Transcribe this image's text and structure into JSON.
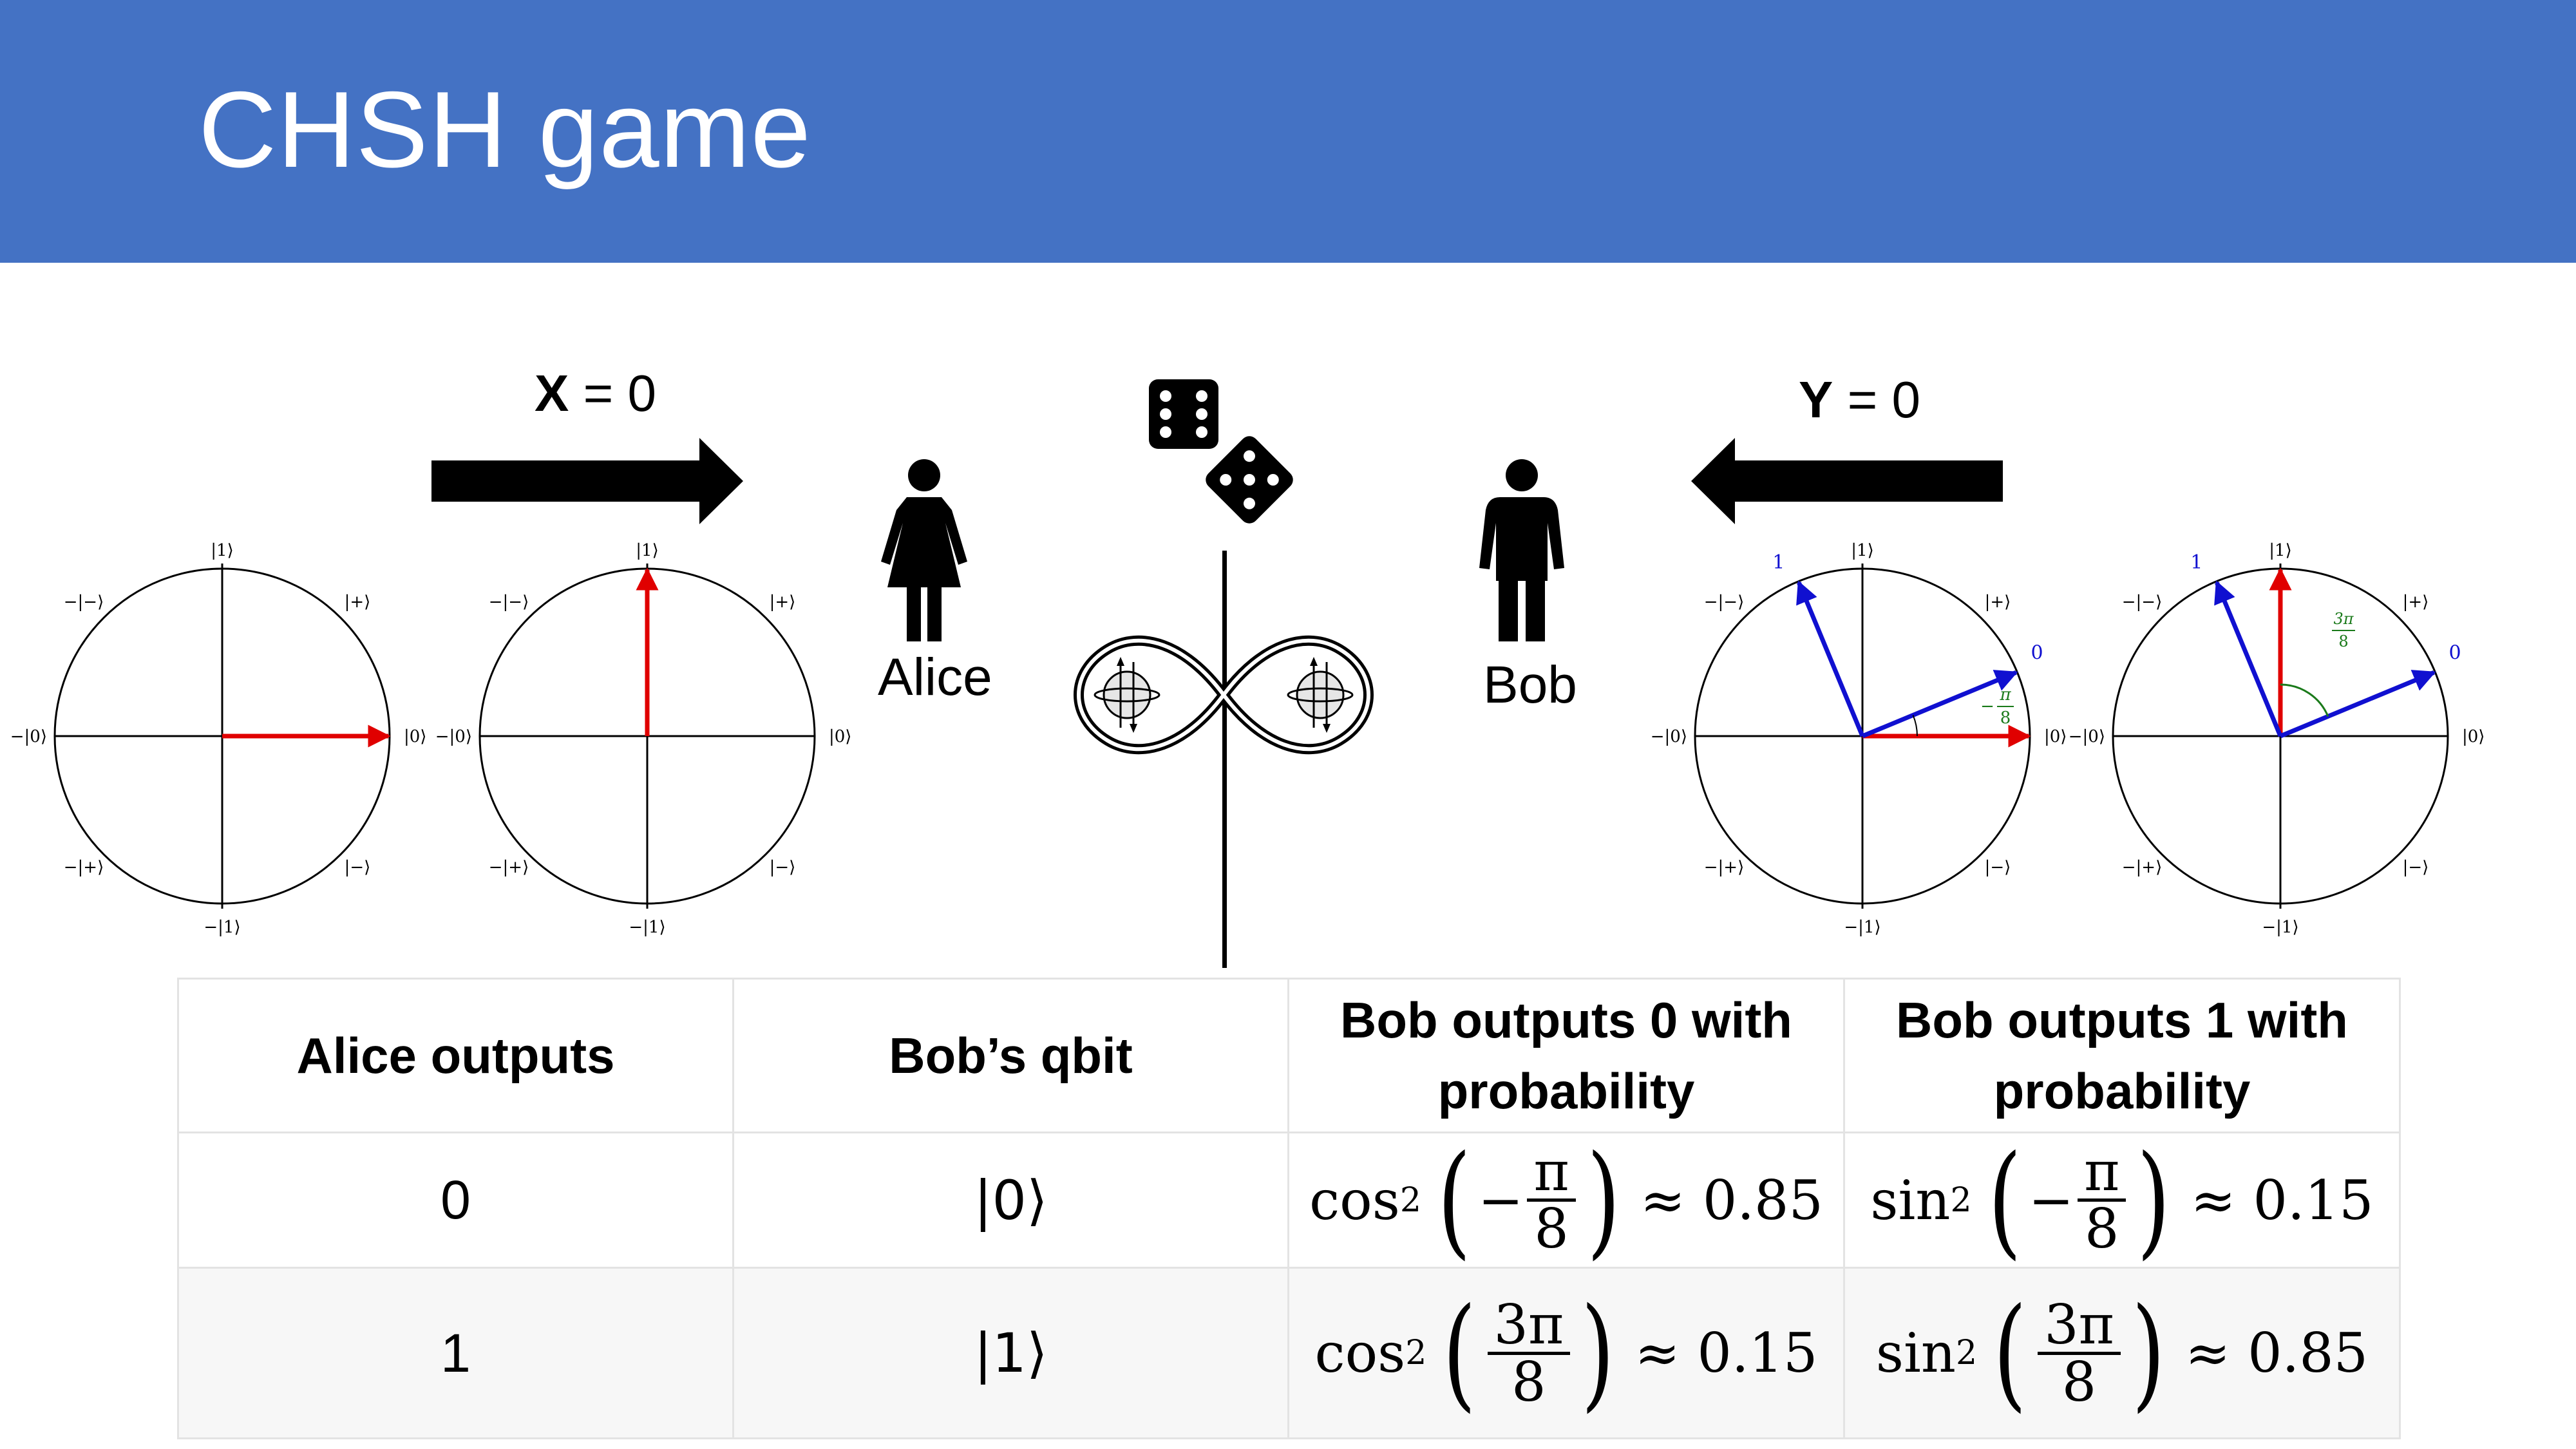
{
  "slide": {
    "title": "CHSH game",
    "header_color": "#4472c4"
  },
  "inputs": {
    "alice_var": "X",
    "alice_eq": " = 0",
    "bob_var": "Y",
    "bob_eq": " = 0"
  },
  "people": {
    "alice": "Alice",
    "bob": "Bob"
  },
  "circle_labels": {
    "ket1": "|1⟩",
    "neg_ket1": "−|1⟩",
    "ket0": "|0⟩",
    "neg_ket0": "−|0⟩",
    "ket_plus": "|+⟩",
    "neg_ket_plus": "−|+⟩",
    "ket_minus": "|−⟩",
    "neg_ket_minus": "−|−⟩",
    "out1": "1",
    "out0": "0"
  },
  "angle_labels": {
    "minus_pi_8": {
      "sign": "−",
      "num": "π",
      "den": "8"
    },
    "three_pi_8": {
      "num": "3π",
      "den": "8"
    }
  },
  "colors": {
    "state_vector": "#e00000",
    "measurement_basis": "#1010d0",
    "angle": "#1a7a1a"
  },
  "table": {
    "headers": [
      "Alice outputs",
      "Bob’s qbit",
      "Bob outputs 0 with probability",
      "Bob outputs 1 with probability"
    ],
    "rows": [
      {
        "alice": "0",
        "qbit": "|0⟩",
        "p0": {
          "fn": "cos",
          "arg_sign": "−",
          "num": "π",
          "den": "8",
          "approx": "≈ 0.85"
        },
        "p1": {
          "fn": "sin",
          "arg_sign": "−",
          "num": "π",
          "den": "8",
          "approx": "≈ 0.15"
        }
      },
      {
        "alice": "1",
        "qbit": "|1⟩",
        "p0": {
          "fn": "cos",
          "arg_sign": "",
          "num": "3π",
          "den": "8",
          "approx": "≈ 0.15"
        },
        "p1": {
          "fn": "sin",
          "arg_sign": "",
          "num": "3π",
          "den": "8",
          "approx": "≈ 0.85"
        }
      }
    ]
  }
}
